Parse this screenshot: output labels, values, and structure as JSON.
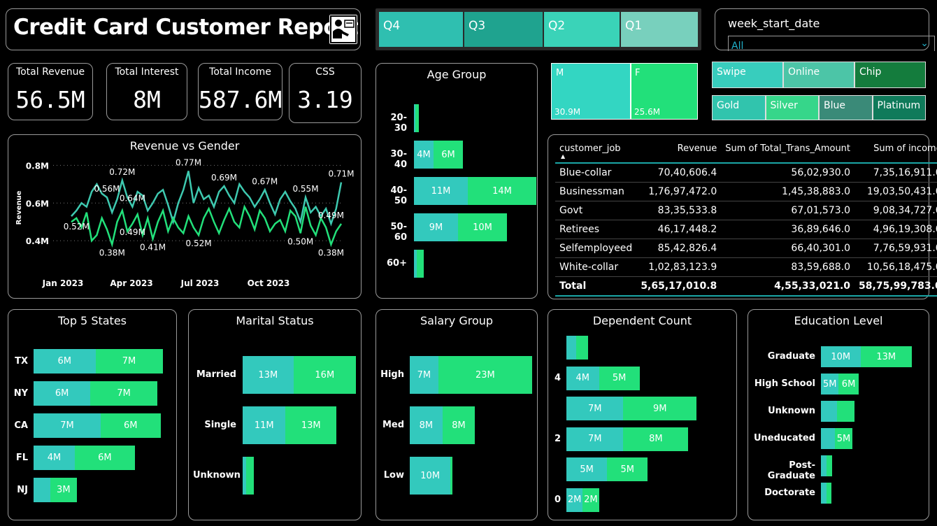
{
  "header": {
    "title": "Credit Card Customer Report",
    "icon": "report-person-icon"
  },
  "quarters": [
    {
      "label": "Q4",
      "color": "#2fbfb0"
    },
    {
      "label": "Q3",
      "color": "#1fa38f"
    },
    {
      "label": "Q2",
      "color": "#3ad3b8"
    },
    {
      "label": "Q1",
      "color": "#78d0bd"
    }
  ],
  "week_slicer": {
    "label": "week_start_date",
    "value": "All"
  },
  "kpis": [
    {
      "label": "Total Revenue",
      "value": "56.5M"
    },
    {
      "label": "Total Interest",
      "value": "8M"
    },
    {
      "label": "Total Income",
      "value": "587.6M"
    },
    {
      "label": "CSS",
      "value": "3.19"
    }
  ],
  "gender_tiles": [
    {
      "label": "M",
      "value": "30.9M",
      "color": "#33d6c2"
    },
    {
      "label": "F",
      "value": "25.6M",
      "color": "#22e07a"
    }
  ],
  "payment_slicer": [
    {
      "label": "Swipe",
      "color": "#38cdbd"
    },
    {
      "label": "Online",
      "color": "#4cc5a7"
    },
    {
      "label": "Chip",
      "color": "#147c3d"
    }
  ],
  "card_slicer": [
    {
      "label": "Gold",
      "color": "#31c4ad"
    },
    {
      "label": "Silver",
      "color": "#36d68a"
    },
    {
      "label": "Blue",
      "color": "#3a8a78"
    },
    {
      "label": "Platinum",
      "color": "#0f7a5a"
    }
  ],
  "colors": {
    "male": "#33c9bd",
    "female": "#22e07a",
    "border": "#9a9a9a"
  },
  "table": {
    "headers": [
      "customer_job",
      "Revenue",
      "Sum of Total_Trans_Amount",
      "Sum of income"
    ],
    "rows": [
      [
        "Blue-collar",
        "70,40,606.4",
        "56,02,930.0",
        "7,35,16,911.0"
      ],
      [
        "Businessman",
        "1,76,97,472.0",
        "1,45,38,883.0",
        "19,03,50,431.0"
      ],
      [
        "Govt",
        "83,35,533.8",
        "67,01,573.0",
        "9,08,34,727.0"
      ],
      [
        "Retirees",
        "46,17,448.2",
        "36,89,646.0",
        "4,96,19,308.0"
      ],
      [
        "Selfemployeed",
        "85,42,826.4",
        "66,40,301.0",
        "7,76,59,931.0"
      ],
      [
        "White-collar",
        "1,02,83,123.9",
        "83,59,688.0",
        "10,56,18,475.0"
      ]
    ],
    "total": [
      "Total",
      "5,65,17,010.8",
      "4,55,33,021.0",
      "58,75,99,783.0"
    ]
  },
  "chart_data": [
    {
      "type": "bar",
      "title": "Age Group",
      "orientation": "horizontal",
      "stacked": true,
      "categories": [
        "20-30",
        "30-40",
        "40-50",
        "50-60",
        "60+"
      ],
      "series": [
        {
          "values": [
            0.3,
            4,
            11,
            9,
            0.6
          ],
          "labels": [
            "",
            "4M",
            "11M",
            "9M",
            ""
          ],
          "color": "#33c9bd"
        },
        {
          "values": [
            0.7,
            6,
            14,
            10,
            1.4
          ],
          "labels": [
            "",
            "6M",
            "14M",
            "10M",
            ""
          ],
          "color": "#22e07a"
        }
      ],
      "xmax": 25
    },
    {
      "type": "line",
      "title": "Revenue vs Gender",
      "ylabel": "Revenue",
      "yticks": [
        "0.4M",
        "0.6M",
        "0.8M"
      ],
      "ylim": [
        0.33,
        0.82
      ],
      "xticks": [
        "Jan 2023",
        "Apr 2023",
        "Jul 2023",
        "Oct 2023"
      ],
      "series": [
        {
          "color": "#3ec9b0",
          "values": [
            0.53,
            0.56,
            0.6,
            0.58,
            0.66,
            0.7,
            0.65,
            0.63,
            0.55,
            0.62,
            0.72,
            0.63,
            0.58,
            0.66,
            0.64,
            0.56,
            0.6,
            0.65,
            0.67,
            0.59,
            0.5,
            0.6,
            0.67,
            0.77,
            0.6,
            0.68,
            0.62,
            0.64,
            0.58,
            0.66,
            0.69,
            0.64,
            0.6,
            0.7,
            0.66,
            0.63,
            0.58,
            0.62,
            0.67,
            0.6,
            0.54,
            0.62,
            0.66,
            0.61,
            0.57,
            0.5,
            0.63,
            0.55,
            0.58,
            0.53,
            0.57,
            0.49,
            0.57,
            0.71
          ]
        },
        {
          "color": "#22e07a",
          "values": [
            0.5,
            0.52,
            0.47,
            0.55,
            0.4,
            0.43,
            0.52,
            0.46,
            0.38,
            0.5,
            0.56,
            0.45,
            0.49,
            0.54,
            0.43,
            0.52,
            0.41,
            0.5,
            0.56,
            0.45,
            0.52,
            0.47,
            0.44,
            0.53,
            0.47,
            0.43,
            0.52,
            0.57,
            0.5,
            0.44,
            0.51,
            0.57,
            0.5,
            0.47,
            0.58,
            0.53,
            0.46,
            0.56,
            0.52,
            0.45,
            0.49,
            0.51,
            0.45,
            0.56,
            0.53,
            0.44,
            0.58,
            0.48,
            0.43,
            0.52,
            0.47,
            0.38,
            0.45,
            0.49
          ]
        }
      ],
      "annotations": [
        {
          "text": "0.52M",
          "i": 1,
          "s": 1
        },
        {
          "text": "0.56M",
          "i": 7,
          "s": 0
        },
        {
          "text": "0.72M",
          "i": 10,
          "s": 0
        },
        {
          "text": "0.38M",
          "i": 8,
          "s": 1
        },
        {
          "text": "0.64M",
          "i": 12,
          "s": 0
        },
        {
          "text": "0.49M",
          "i": 12,
          "s": 1
        },
        {
          "text": "0.41M",
          "i": 16,
          "s": 1
        },
        {
          "text": "0.77M",
          "i": 23,
          "s": 0
        },
        {
          "text": "0.52M",
          "i": 25,
          "s": 1
        },
        {
          "text": "0.69M",
          "i": 30,
          "s": 0
        },
        {
          "text": "0.67M",
          "i": 38,
          "s": 0
        },
        {
          "text": "0.55M",
          "i": 46,
          "s": 0
        },
        {
          "text": "0.50M",
          "i": 45,
          "s": 1
        },
        {
          "text": "0.49M",
          "i": 51,
          "s": 0
        },
        {
          "text": "0.38M",
          "i": 51,
          "s": 1
        },
        {
          "text": "0.71M",
          "i": 53,
          "s": 0
        }
      ]
    },
    {
      "type": "bar",
      "title": "Top 5 States",
      "orientation": "horizontal",
      "stacked": true,
      "categories": [
        "TX",
        "NY",
        "CA",
        "FL",
        "NJ"
      ],
      "series": [
        {
          "values": [
            6,
            5.5,
            6.5,
            4,
            1.6
          ],
          "labels": [
            "6M",
            "6M",
            "7M",
            "4M",
            ""
          ],
          "color": "#33c9bd"
        },
        {
          "values": [
            6.5,
            6.5,
            5.8,
            5.8,
            2.6
          ],
          "labels": [
            "7M",
            "7M",
            "6M",
            "6M",
            "3M"
          ],
          "color": "#22e07a"
        }
      ],
      "xmax": 12.6
    },
    {
      "type": "bar",
      "title": "Marital Status",
      "orientation": "horizontal",
      "stacked": true,
      "categories": [
        "Married",
        "Single",
        "Unknown"
      ],
      "series": [
        {
          "values": [
            13,
            11,
            0.9
          ],
          "labels": [
            "13M",
            "11M",
            ""
          ],
          "color": "#33c9bd"
        },
        {
          "values": [
            16,
            13,
            2
          ],
          "labels": [
            "16M",
            "13M",
            ""
          ],
          "color": "#22e07a"
        }
      ],
      "xmax": 29
    },
    {
      "type": "bar",
      "title": "Salary Group",
      "orientation": "horizontal",
      "stacked": true,
      "categories": [
        "High",
        "Med",
        "Low"
      ],
      "series": [
        {
          "values": [
            7,
            8,
            10
          ],
          "labels": [
            "7M",
            "8M",
            "10M"
          ],
          "color": "#33c9bd"
        },
        {
          "values": [
            23,
            8,
            0.4
          ],
          "labels": [
            "23M",
            "8M",
            ""
          ],
          "color": "#22e07a"
        }
      ],
      "xmax": 30
    },
    {
      "type": "bar",
      "title": "Dependent Count",
      "orientation": "horizontal",
      "stacked": true,
      "categories": [
        "5",
        "4",
        "3",
        "2",
        "1",
        "0"
      ],
      "category_labels": [
        "",
        "4",
        "",
        "2",
        "",
        "0"
      ],
      "series": [
        {
          "values": [
            1.2,
            4,
            7,
            7,
            5,
            2
          ],
          "labels": [
            "",
            "4M",
            "7M",
            "7M",
            "5M",
            "2M"
          ],
          "color": "#33c9bd"
        },
        {
          "values": [
            1.5,
            5,
            9,
            8,
            5,
            2
          ],
          "labels": [
            "",
            "5M",
            "9M",
            "8M",
            "5M",
            "2M"
          ],
          "color": "#22e07a"
        }
      ],
      "xmax": 16
    },
    {
      "type": "bar",
      "title": "Education Level",
      "orientation": "horizontal",
      "stacked": true,
      "categories": [
        "Graduate",
        "High School",
        "Unknown",
        "Uneducated",
        "Post-Graduate",
        "Doctorate"
      ],
      "series": [
        {
          "values": [
            10,
            4.5,
            4,
            3.5,
            1.5,
            1.5
          ],
          "labels": [
            "10M",
            "5M",
            "",
            "",
            "",
            ""
          ],
          "color": "#33c9bd"
        },
        {
          "values": [
            13,
            5,
            4.5,
            4.5,
            1.3,
            1.1
          ],
          "labels": [
            "13M",
            "6M",
            "",
            "5M",
            "",
            ""
          ],
          "color": "#22e07a"
        }
      ],
      "xmax": 23
    }
  ]
}
